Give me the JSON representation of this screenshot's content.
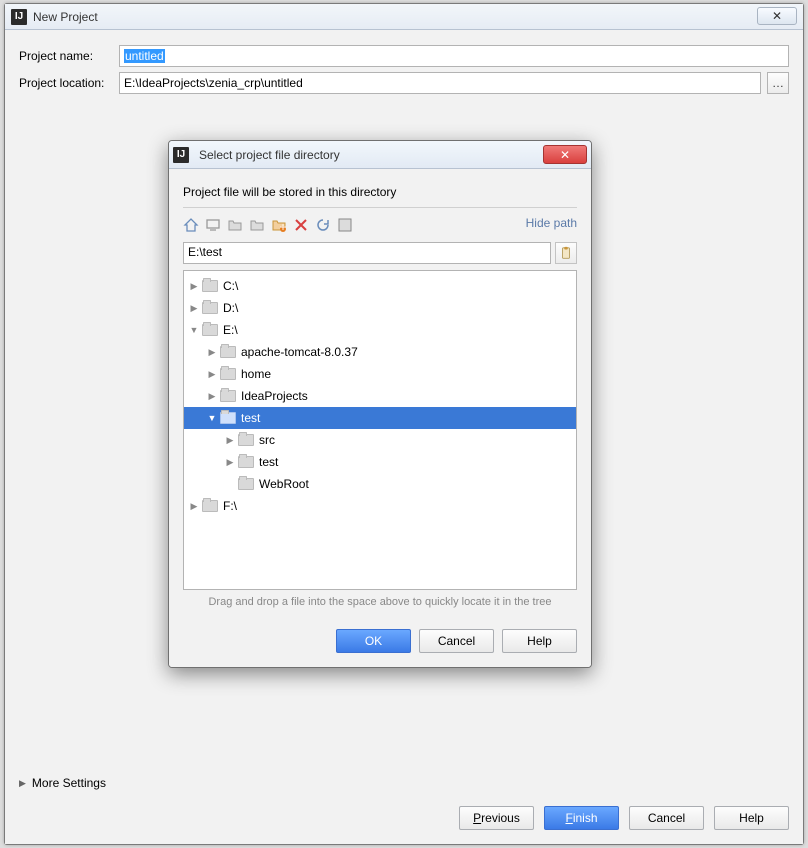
{
  "outer": {
    "title": "New Project",
    "close_glyph": "✕",
    "name_label": "Project name:",
    "name_value": "untitled",
    "location_label": "Project location:",
    "location_value": "E:\\IdeaProjects\\zenia_crp\\untitled",
    "browse_glyph": "…",
    "more_settings": "More Settings",
    "buttons": {
      "previous": "Previous",
      "finish": "Finish",
      "cancel": "Cancel",
      "help": "Help"
    }
  },
  "modal": {
    "title": "Select project file directory",
    "close_glyph": "✕",
    "subtitle": "Project file will be stored in this directory",
    "hide_path": "Hide path",
    "path_value": "E:\\test",
    "tree": [
      {
        "depth": 0,
        "arrow": "▶",
        "label": "C:\\"
      },
      {
        "depth": 0,
        "arrow": "▶",
        "label": "D:\\"
      },
      {
        "depth": 0,
        "arrow": "▼",
        "label": "E:\\"
      },
      {
        "depth": 1,
        "arrow": "▶",
        "label": "apache-tomcat-8.0.37"
      },
      {
        "depth": 1,
        "arrow": "▶",
        "label": "home"
      },
      {
        "depth": 1,
        "arrow": "▶",
        "label": "IdeaProjects"
      },
      {
        "depth": 1,
        "arrow": "▼",
        "label": "test",
        "selected": true
      },
      {
        "depth": 2,
        "arrow": "▶",
        "label": "src"
      },
      {
        "depth": 2,
        "arrow": "▶",
        "label": "test"
      },
      {
        "depth": 2,
        "arrow": "",
        "label": "WebRoot"
      },
      {
        "depth": 0,
        "arrow": "▶",
        "label": "F:\\"
      }
    ],
    "drop_hint": "Drag and drop a file into the space above to quickly locate it in the tree",
    "buttons": {
      "ok": "OK",
      "cancel": "Cancel",
      "help": "Help"
    }
  }
}
